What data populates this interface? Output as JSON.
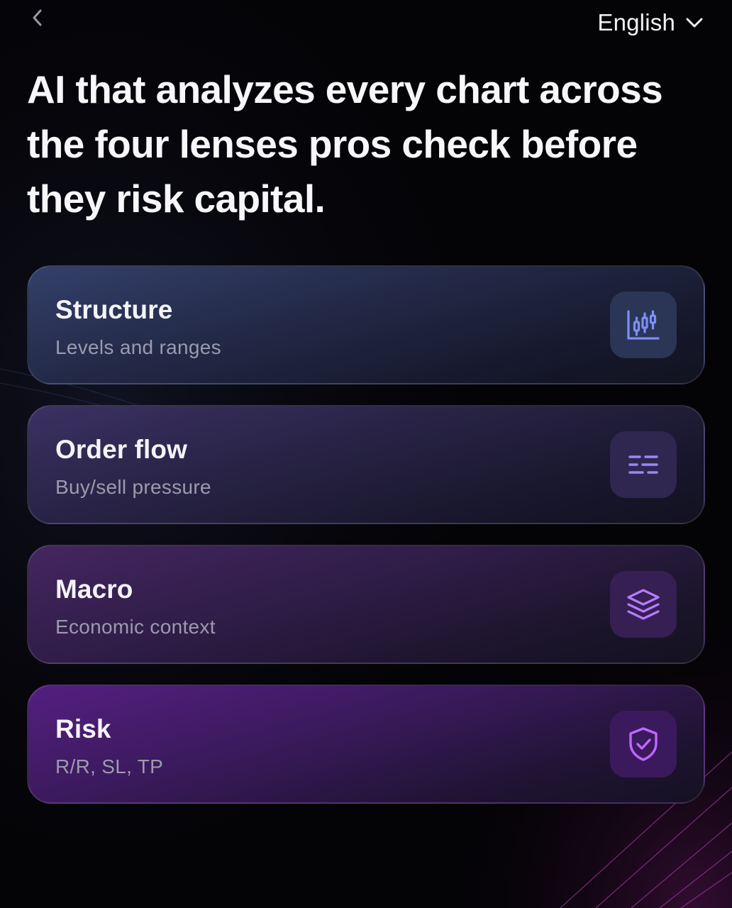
{
  "header": {
    "back_icon": "chevron-left-icon",
    "language": {
      "selected": "English",
      "icon": "chevron-down-icon"
    }
  },
  "headline": "AI that analyzes every chart across the four lenses pros check before they risk capital.",
  "lenses": [
    {
      "title": "Structure",
      "subtitle": "Levels and ranges",
      "icon": "candlestick-chart-icon",
      "icon_color": "#7d8dff"
    },
    {
      "title": "Order flow",
      "subtitle": "Buy/sell pressure",
      "icon": "order-flow-lines-icon",
      "icon_color": "#9b86ff"
    },
    {
      "title": "Macro",
      "subtitle": "Economic context",
      "icon": "layers-icon",
      "icon_color": "#b77bff"
    },
    {
      "title": "Risk",
      "subtitle": "R/R, SL, TP",
      "icon": "shield-check-icon",
      "icon_color": "#c067ff"
    }
  ],
  "colors": {
    "background": "#040306",
    "text_primary": "#f7f6f9",
    "text_secondary": "#9c9aae"
  }
}
